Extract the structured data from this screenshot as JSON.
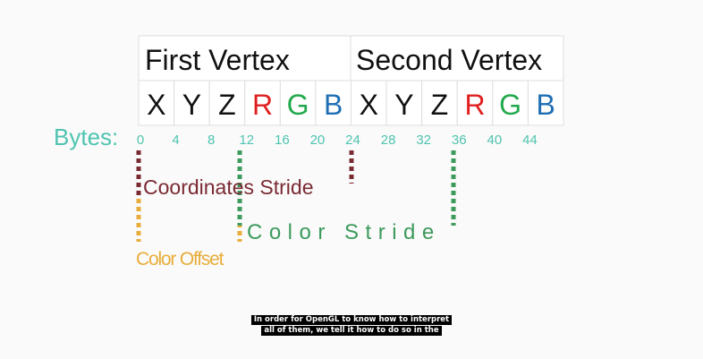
{
  "vertex_headers": [
    "First Vertex",
    "Second Vertex"
  ],
  "attribute_cells": [
    {
      "text": "X",
      "color": "#111111"
    },
    {
      "text": "Y",
      "color": "#111111"
    },
    {
      "text": "Z",
      "color": "#111111"
    },
    {
      "text": "R",
      "color": "#e02020"
    },
    {
      "text": "G",
      "color": "#22a94c"
    },
    {
      "text": "B",
      "color": "#1f6fb3"
    },
    {
      "text": "X",
      "color": "#111111"
    },
    {
      "text": "Y",
      "color": "#111111"
    },
    {
      "text": "Z",
      "color": "#111111"
    },
    {
      "text": "R",
      "color": "#e02020"
    },
    {
      "text": "G",
      "color": "#22a94c"
    },
    {
      "text": "B",
      "color": "#1f6fb3"
    }
  ],
  "bytes_label": "Bytes:",
  "byte_offsets": [
    "0",
    "4",
    "8",
    "12",
    "16",
    "20",
    "24",
    "28",
    "32",
    "36",
    "40",
    "44"
  ],
  "labels": {
    "coordinates_stride": "Coordinates Stride",
    "color_stride": "Color Stride",
    "color_offset": "Color Offset"
  },
  "colors": {
    "teal": "#4fc4b0",
    "coordinates": "#7a2a33",
    "color_stride": "#3c9a5c",
    "color_offset": "#e8ad3a",
    "grid": "#dedede"
  },
  "subtitle": [
    "In order for OpenGL to know how to interpret",
    "all of them, we tell it how to do so in the"
  ]
}
